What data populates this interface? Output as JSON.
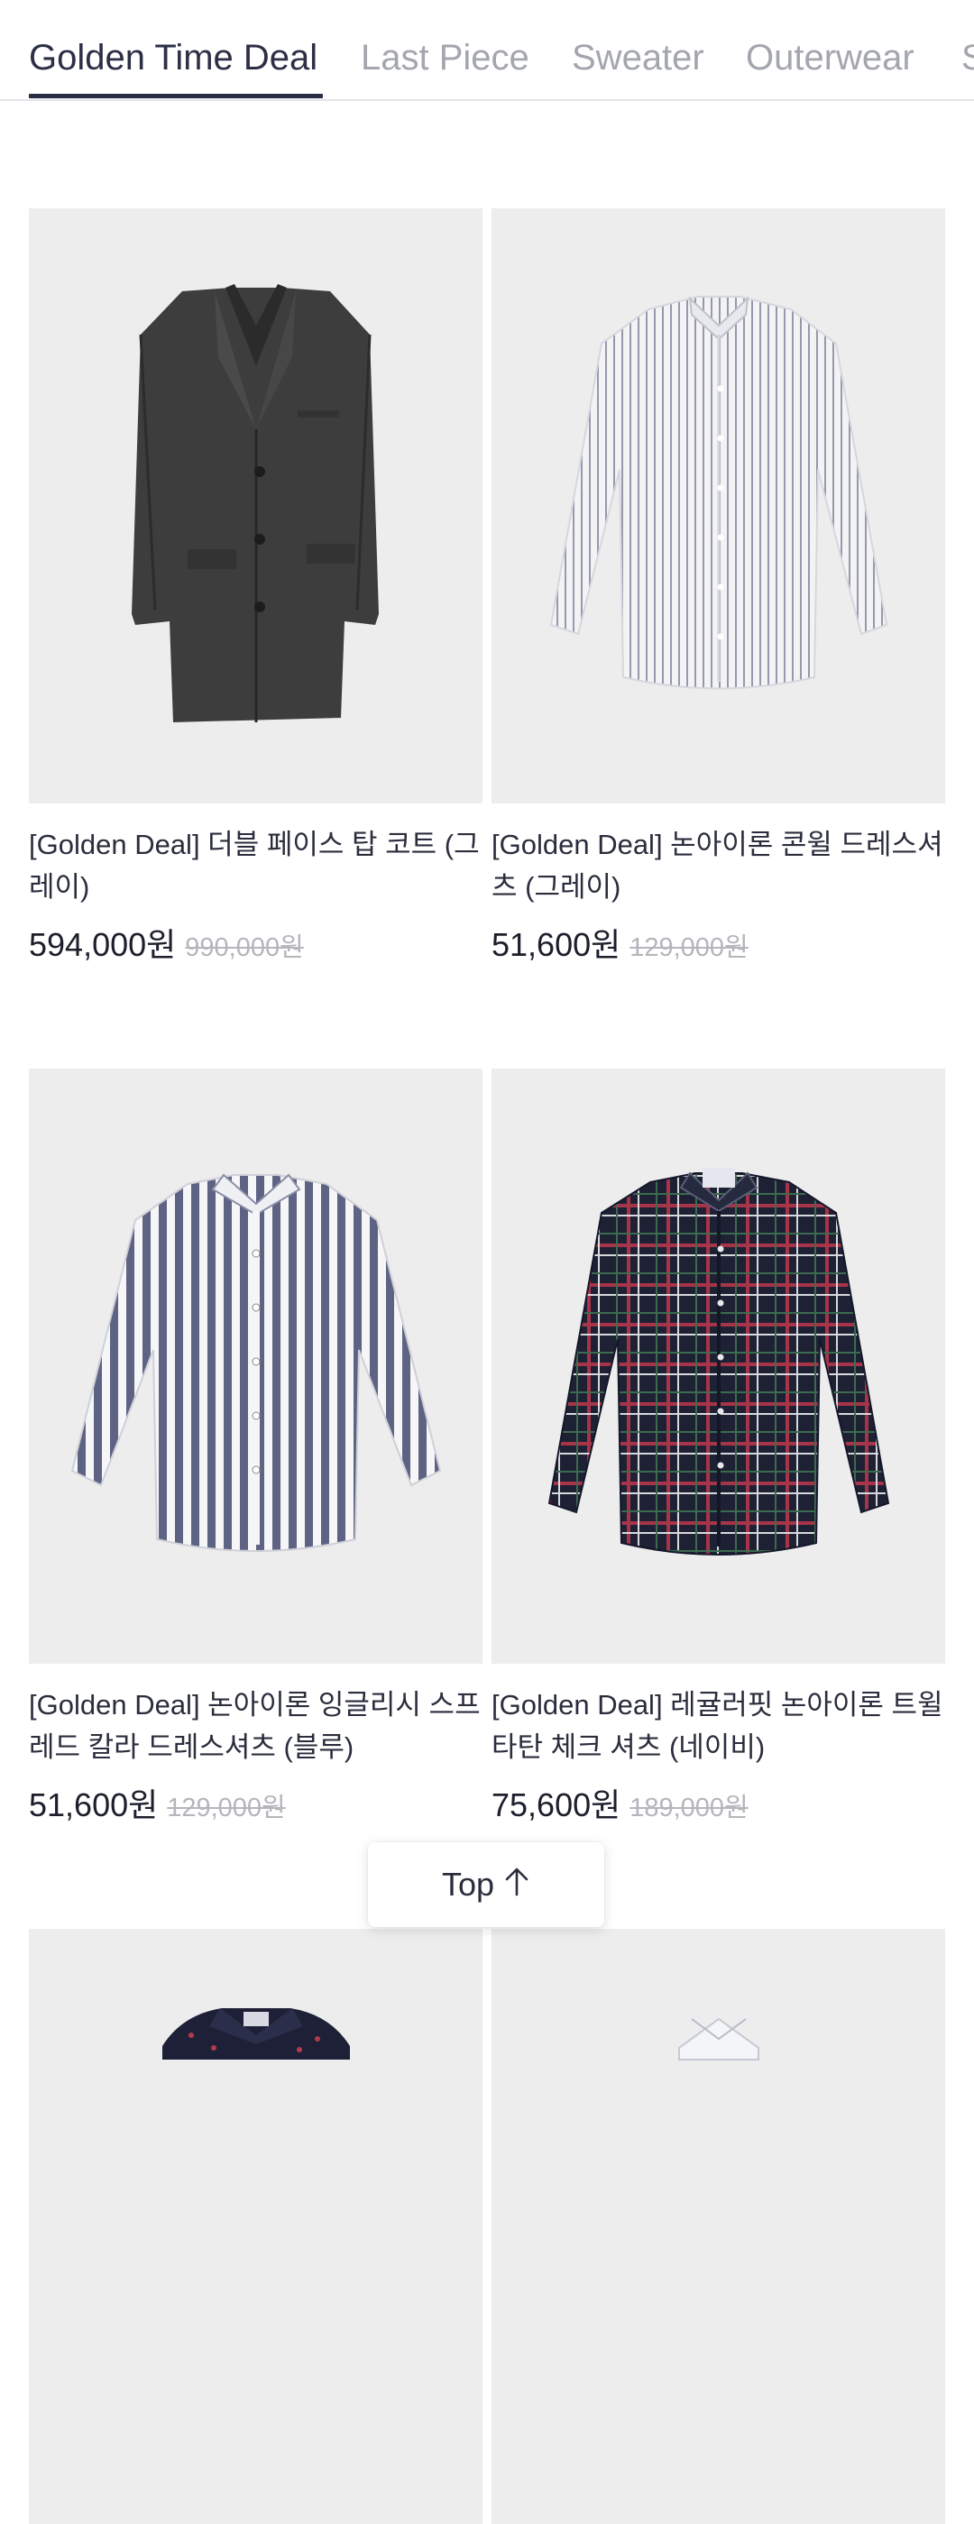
{
  "tabs": [
    {
      "label": "Golden Time Deal",
      "active": true
    },
    {
      "label": "Last Piece",
      "active": false
    },
    {
      "label": "Sweater",
      "active": false
    },
    {
      "label": "Outerwear",
      "active": false
    },
    {
      "label": "S",
      "active": false
    }
  ],
  "products": [
    {
      "name": "[Golden Deal] 더블 페이스 탑 코트 (그레이)",
      "price": "594,000원",
      "original_price": "990,000원",
      "image": "gray-coat"
    },
    {
      "name": "[Golden Deal] 논아이론 콘윌 드레스셔츠 (그레이)",
      "price": "51,600원",
      "original_price": "129,000원",
      "image": "gray-striped-dress-shirt"
    },
    {
      "name": "[Golden Deal] 논아이론 잉글리시 스프레드 칼라 드레스셔츠 (블루)",
      "price": "51,600원",
      "original_price": "129,000원",
      "image": "blue-striped-dress-shirt"
    },
    {
      "name": "[Golden Deal] 레귤러핏 논아이론 트윌 타탄 체크 셔츠 (네이비)",
      "price": "75,600원",
      "original_price": "189,000원",
      "image": "navy-tartan-shirt"
    }
  ],
  "top_button": {
    "label": "Top",
    "icon": "arrow-up-icon"
  }
}
